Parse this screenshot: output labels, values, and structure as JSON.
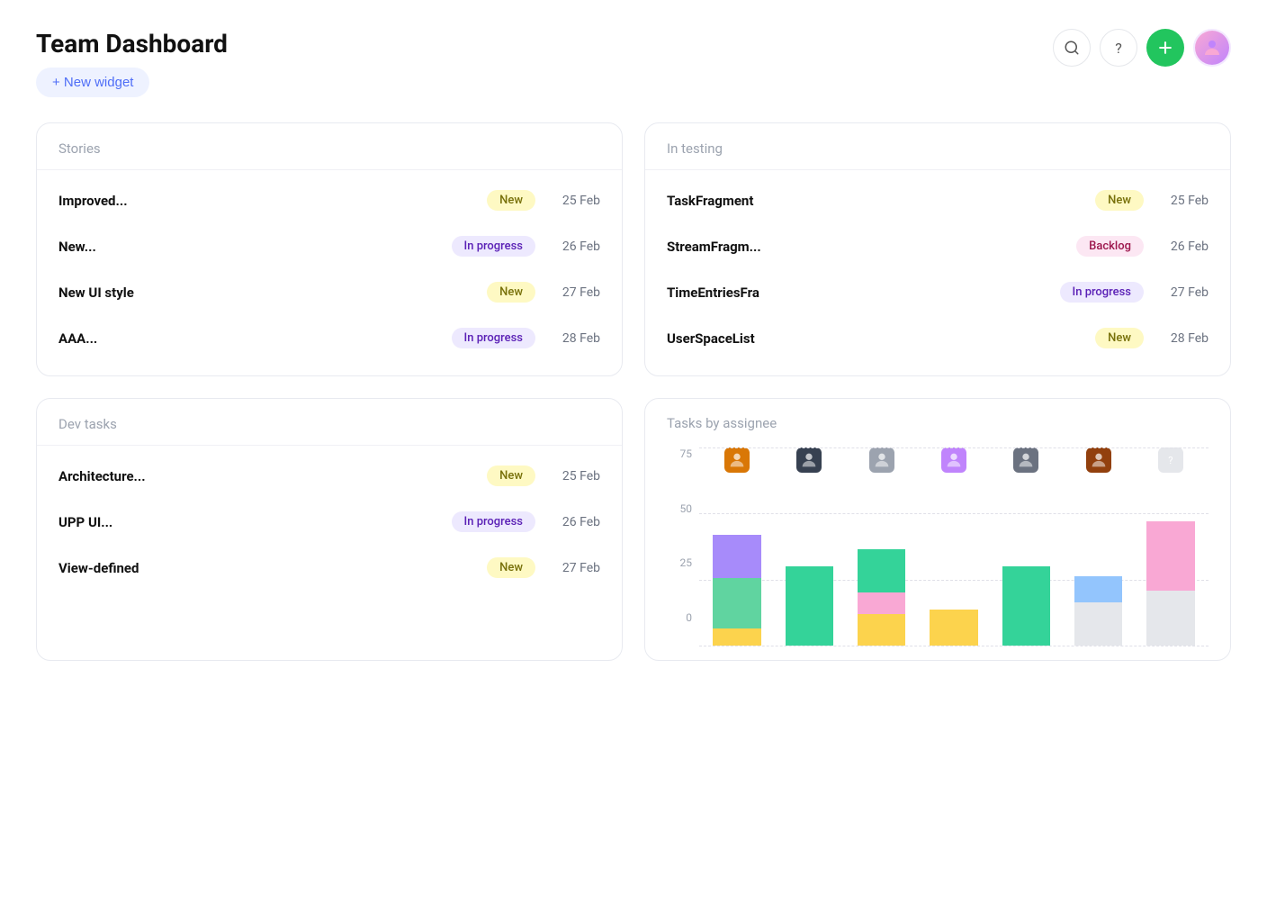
{
  "header": {
    "title": "Team Dashboard",
    "new_widget_label": "+ New widget",
    "actions": {
      "search_icon": "🔍",
      "help_icon": "?",
      "add_icon": "+",
      "avatar_label": "👤"
    }
  },
  "widgets": {
    "stories": {
      "title": "Stories",
      "items": [
        {
          "name": "Improved...",
          "badge": "New",
          "badge_type": "new",
          "date": "25 Feb"
        },
        {
          "name": "New...",
          "badge": "In progress",
          "badge_type": "inprogress",
          "date": "26 Feb"
        },
        {
          "name": "New UI style",
          "badge": "New",
          "badge_type": "new",
          "date": "27 Feb"
        },
        {
          "name": "AAA...",
          "badge": "In progress",
          "badge_type": "inprogress",
          "date": "28 Feb"
        }
      ]
    },
    "in_testing": {
      "title": "In testing",
      "items": [
        {
          "name": "TaskFragment",
          "badge": "New",
          "badge_type": "new",
          "date": "25 Feb"
        },
        {
          "name": "StreamFragm...",
          "badge": "Backlog",
          "badge_type": "backlog",
          "date": "26 Feb"
        },
        {
          "name": "TimeEntriesFra",
          "badge": "In progress",
          "badge_type": "inprogress",
          "date": "27 Feb"
        },
        {
          "name": "UserSpaceList",
          "badge": "New",
          "badge_type": "new",
          "date": "28 Feb"
        }
      ]
    },
    "dev_tasks": {
      "title": "Dev tasks",
      "items": [
        {
          "name": "Architecture...",
          "badge": "New",
          "badge_type": "new",
          "date": "25 Feb"
        },
        {
          "name": "UPP UI...",
          "badge": "In progress",
          "badge_type": "inprogress",
          "date": "26 Feb"
        },
        {
          "name": "View-defined",
          "badge": "New",
          "badge_type": "new",
          "date": "27 Feb"
        }
      ]
    },
    "tasks_by_assignee": {
      "title": "Tasks by assignee",
      "y_labels": [
        "75",
        "50",
        "25",
        "0"
      ],
      "bars": [
        {
          "avatar_color": "#d97706",
          "avatar_text": "👤",
          "segments": [
            {
              "color": "#a78bfa",
              "height_pct": 30
            },
            {
              "color": "#60d4a0",
              "height_pct": 35
            },
            {
              "color": "#fcd34d",
              "height_pct": 12
            }
          ]
        },
        {
          "avatar_color": "#374151",
          "avatar_text": "👤",
          "segments": [
            {
              "color": "#34d399",
              "height_pct": 55
            },
            {
              "color": "#fcd34d",
              "height_pct": 0
            },
            {
              "color": "#a78bfa",
              "height_pct": 0
            }
          ]
        },
        {
          "avatar_color": "#9ca3af",
          "avatar_text": "👤",
          "segments": [
            {
              "color": "#34d399",
              "height_pct": 30
            },
            {
              "color": "#f9a8d4",
              "height_pct": 15
            },
            {
              "color": "#fcd34d",
              "height_pct": 22
            }
          ]
        },
        {
          "avatar_color": "#c084fc",
          "avatar_text": "👤",
          "segments": [
            {
              "color": "#fcd34d",
              "height_pct": 25
            },
            {
              "color": "#34d399",
              "height_pct": 0
            },
            {
              "color": "#a78bfa",
              "height_pct": 0
            }
          ]
        },
        {
          "avatar_color": "#6b7280",
          "avatar_text": "👤",
          "segments": [
            {
              "color": "#34d399",
              "height_pct": 55
            },
            {
              "color": "#a78bfa",
              "height_pct": 0
            },
            {
              "color": "#fcd34d",
              "height_pct": 0
            }
          ]
        },
        {
          "avatar_color": "#92400e",
          "avatar_text": "👤",
          "segments": [
            {
              "color": "#93c5fd",
              "height_pct": 18
            },
            {
              "color": "#e5e7eb",
              "height_pct": 30
            },
            {
              "color": "#a78bfa",
              "height_pct": 0
            }
          ]
        },
        {
          "avatar_color": "#e5e7eb",
          "avatar_text": "?",
          "segments": [
            {
              "color": "#f9a8d4",
              "height_pct": 48
            },
            {
              "color": "#e5e7eb",
              "height_pct": 38
            },
            {
              "color": "#a78bfa",
              "height_pct": 0
            }
          ]
        }
      ]
    }
  }
}
